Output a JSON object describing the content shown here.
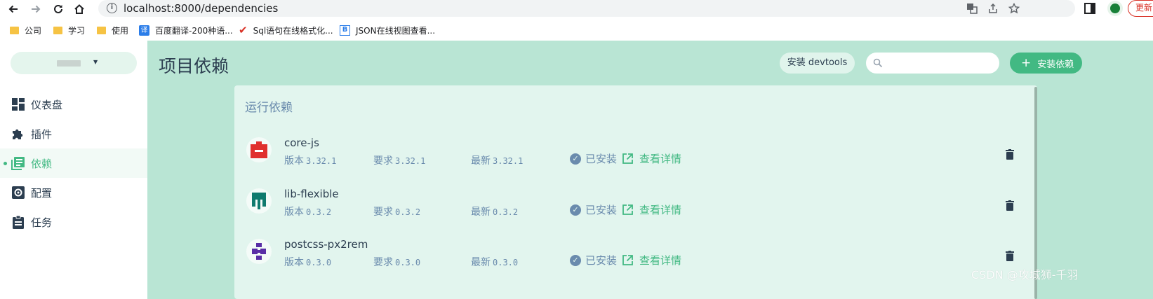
{
  "browser": {
    "url": "localhost:8000/dependencies",
    "update_label": "更新",
    "bookmarks": [
      {
        "label": "公司",
        "icon": "folder-icon"
      },
      {
        "label": "学习",
        "icon": "folder-icon"
      },
      {
        "label": "使用",
        "icon": "folder-icon"
      },
      {
        "label": "百度翻译-200种语...",
        "icon": "baidu-translate-icon"
      },
      {
        "label": "Sql语句在线格式化...",
        "icon": "red-check-icon"
      },
      {
        "label": "JSON在线视图查看...",
        "icon": "json-viewer-icon"
      }
    ]
  },
  "sidebar": {
    "items": [
      {
        "label": "仪表盘",
        "icon": "dashboard-icon"
      },
      {
        "label": "插件",
        "icon": "puzzle-icon"
      },
      {
        "label": "依赖",
        "icon": "library-icon",
        "active": true
      },
      {
        "label": "配置",
        "icon": "settings-icon"
      },
      {
        "label": "任务",
        "icon": "clipboard-icon"
      }
    ]
  },
  "header": {
    "title": "项目依赖",
    "devtools_label": "安装 devtools",
    "search_placeholder": "",
    "install_label": "安装依赖"
  },
  "dependencies": {
    "section_title": "运行依赖",
    "labels": {
      "version": "版本",
      "wanted": "要求",
      "latest": "最新",
      "installed": "已安装",
      "details": "查看详情"
    },
    "items": [
      {
        "name": "core-js",
        "version": "3.32.1",
        "wanted": "3.32.1",
        "latest": "3.32.1",
        "logo_color": "#e0302e"
      },
      {
        "name": "lib-flexible",
        "version": "0.3.2",
        "wanted": "0.3.2",
        "latest": "0.3.2",
        "logo_color": "#0f7a6e"
      },
      {
        "name": "postcss-px2rem",
        "version": "0.3.0",
        "wanted": "0.3.0",
        "latest": "0.3.0",
        "logo_color": "#5a2ea6"
      }
    ]
  },
  "watermark": "CSDN @攻城狮-千羽",
  "colors": {
    "accent": "#42b983",
    "main_bg": "#b9e5d4",
    "panel_bg": "#e2f5ee",
    "muted_text": "#6a8bad"
  }
}
